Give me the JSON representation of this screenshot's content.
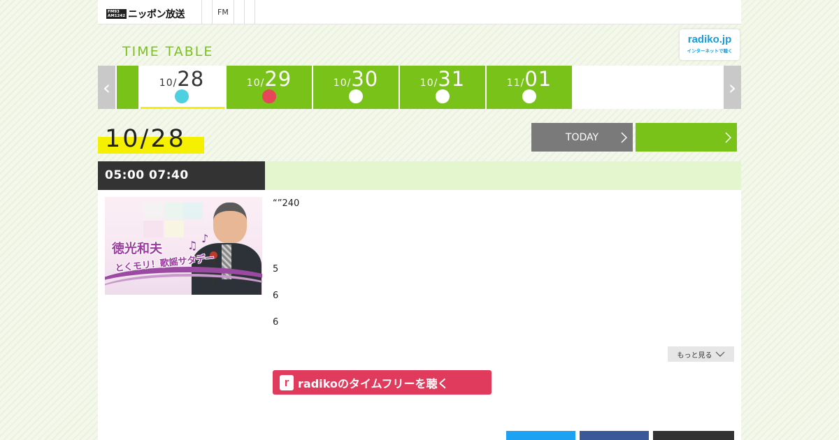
{
  "header": {
    "logo_badge_top": "FM93",
    "logo_badge_bottom": "AM1242",
    "logo_text": "ニッポン放送",
    "nav": [
      "",
      "FM",
      "",
      ""
    ]
  },
  "radiko": {
    "logo": "radiko.jp",
    "tagline": "インターネットで聴く"
  },
  "timetable": {
    "title": "TIME TABLE",
    "prev_arrow": "‹",
    "next_arrow": "›",
    "dates": [
      {
        "month": "10/",
        "day": "28",
        "dot_color": "#4fd0e0",
        "active": true
      },
      {
        "month": "10/",
        "day": "29",
        "dot_color": "#e64658",
        "active": false
      },
      {
        "month": "10/",
        "day": "30",
        "dot_color": "#ffffff",
        "active": false
      },
      {
        "month": "10/",
        "day": "31",
        "dot_color": "#ffffff",
        "active": false
      },
      {
        "month": "11/",
        "day": "01",
        "dot_color": "#ffffff",
        "active": false
      }
    ]
  },
  "selected_date": "10/28",
  "today_label": "TODAY",
  "program": {
    "time": "05:00  07:40",
    "thumb_title": "徳光和夫",
    "thumb_subtitle": "とくモリ！歌謡サタデー",
    "description": "“”240",
    "lines": [
      "5",
      "6",
      "6"
    ],
    "more_label": "もっと見る",
    "radiko_label": "radikoのタイムフリーを聴く",
    "radiko_icon": "r"
  },
  "colors": {
    "accent_green": "#79c21a",
    "highlight_yellow": "#f5ef00",
    "radiko_pink": "#e03a5c",
    "dark": "#333333"
  }
}
